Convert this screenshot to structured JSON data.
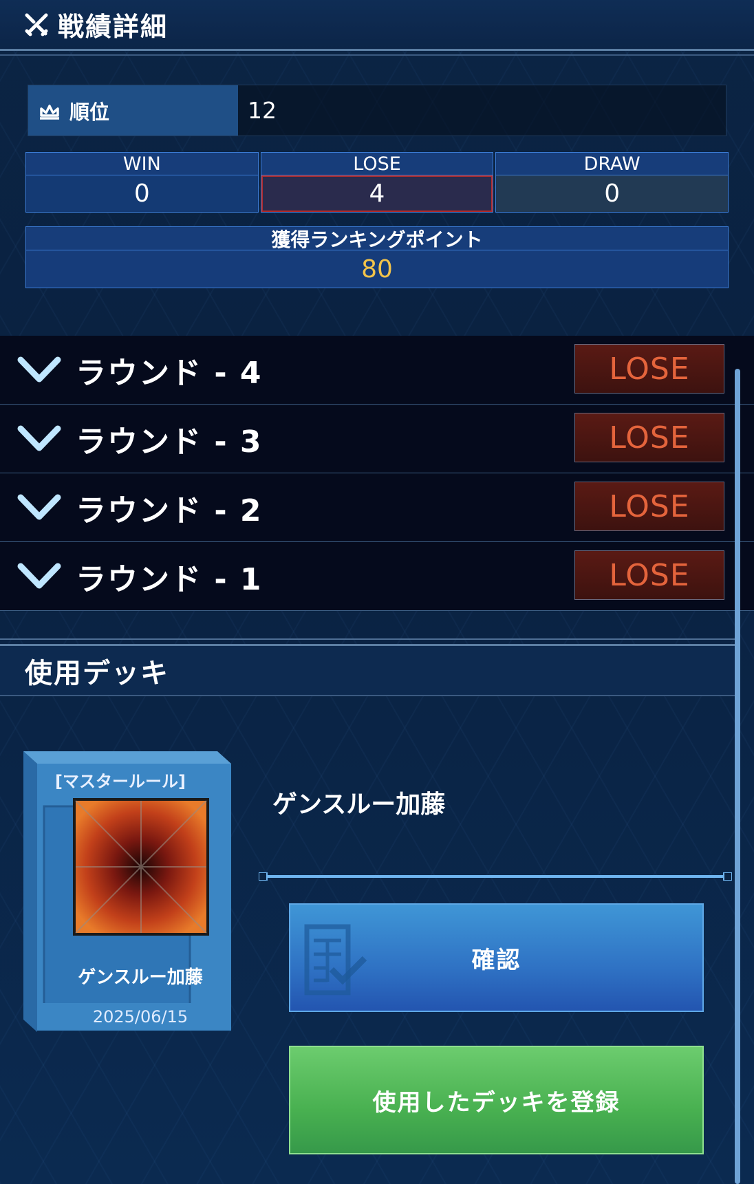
{
  "header": {
    "title": "戦績詳細",
    "icon": "crossed-swords-icon"
  },
  "rank": {
    "label": "順位",
    "value": "12",
    "icon": "crown-icon"
  },
  "stats": {
    "win_label": "WIN",
    "win_value": "0",
    "lose_label": "LOSE",
    "lose_value": "4",
    "draw_label": "DRAW",
    "draw_value": "0"
  },
  "points": {
    "label": "獲得ランキングポイント",
    "value": "80",
    "value_color": "#f2c34a"
  },
  "rounds": [
    {
      "label": "ラウンド - 4",
      "result": "LOSE"
    },
    {
      "label": "ラウンド - 3",
      "result": "LOSE"
    },
    {
      "label": "ラウンド - 2",
      "result": "LOSE"
    },
    {
      "label": "ラウンド - 1",
      "result": "LOSE"
    }
  ],
  "deck": {
    "section_title": "使用デッキ",
    "rule_tag": "[マスタールール]",
    "name": "ゲンスルー加藤",
    "box_name": "ゲンスルー加藤",
    "date": "2025/06/15",
    "confirm_label": "確認",
    "register_label": "使用したデッキを登録"
  },
  "colors": {
    "lose_text": "#e4643c",
    "confirm_button": "#2f72c4",
    "register_button": "#48b050"
  }
}
